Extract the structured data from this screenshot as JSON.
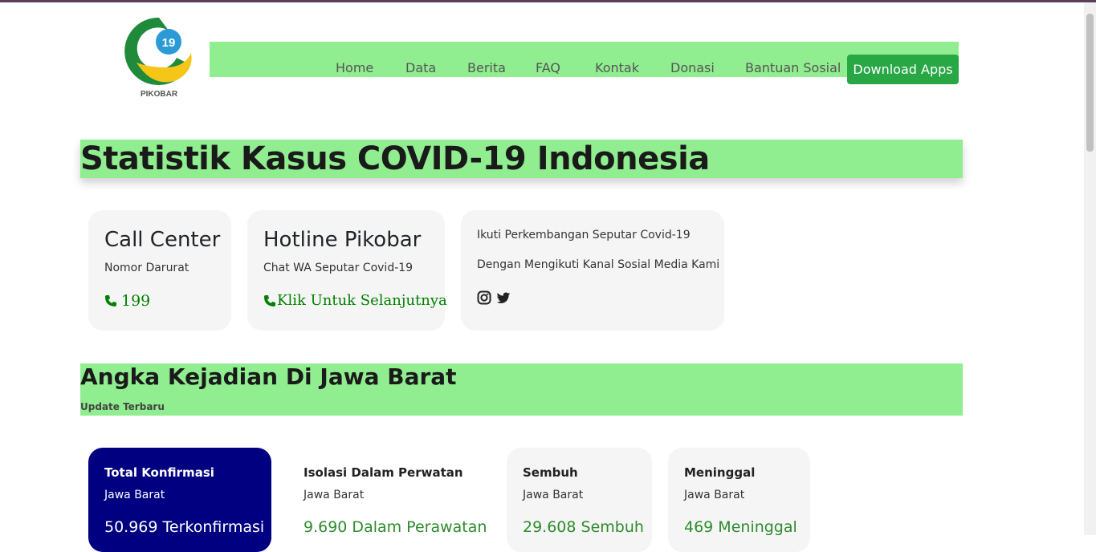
{
  "logo": {
    "text": "PIKOBAR",
    "badge": "19",
    "colors": {
      "green": "#1e8a3a",
      "yellow": "#f5c518",
      "blue": "#2b9bd8"
    }
  },
  "nav": {
    "items": [
      "Home",
      "Data",
      "Berita",
      "FAQ",
      "Kontak",
      "Donasi",
      "Bantuan Sosial"
    ],
    "download_label": "Download Apps"
  },
  "hero": {
    "title": "Statistik Kasus COVID-19 Indonesia"
  },
  "cards": {
    "call_center": {
      "title": "Call Center",
      "subtitle": "Nomor Darurat",
      "number": "199",
      "icon": "phone-icon"
    },
    "hotline": {
      "title": "Hotline Pikobar",
      "subtitle": "Chat WA Seputar Covid-19",
      "link": "Klik Untuk Selanjutnya",
      "icon": "phone-icon"
    },
    "social": {
      "line1": "Ikuti Perkembangan Seputar Covid-19",
      "line2": "Dengan Mengikuti Kanal Sosial Media Kami",
      "icons": [
        "instagram-icon",
        "twitter-icon"
      ]
    }
  },
  "section": {
    "title": "Angka Kejadian Di Jawa Barat",
    "subtitle": "Update Terbaru"
  },
  "stats": [
    {
      "label": "Total Konfirmasi",
      "region": "Jawa Barat",
      "value": "50.969 Terkonfirmasi"
    },
    {
      "label": "Isolasi Dalam Perwatan",
      "region": "Jawa Barat",
      "value": "9.690 Dalam Perawatan"
    },
    {
      "label": "Sembuh",
      "region": "Jawa Barat",
      "value": "29.608 Sembuh"
    },
    {
      "label": "Meninggal",
      "region": "Jawa Barat",
      "value": "469 Meninggal"
    }
  ],
  "colors": {
    "nav_bg": "#90ee90",
    "accent_green": "#28a745",
    "link_green": "#008000",
    "confirm_bg": "#000080"
  }
}
